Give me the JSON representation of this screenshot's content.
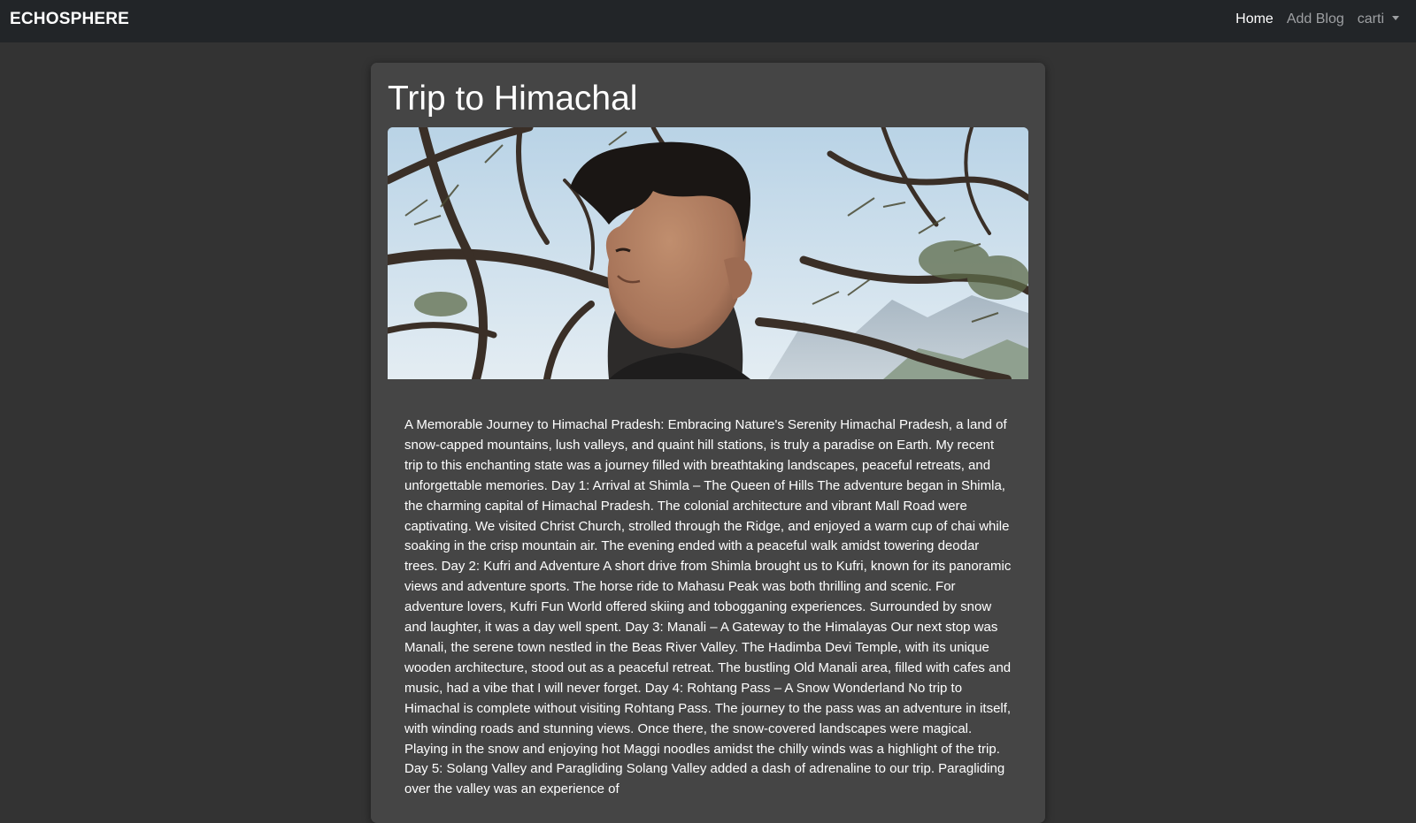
{
  "navbar": {
    "brand": "ECHOSPHERE",
    "links": [
      {
        "label": "Home",
        "active": true
      },
      {
        "label": "Add Blog",
        "active": false
      }
    ],
    "user_menu": "carti"
  },
  "post": {
    "title": "Trip to Himachal",
    "image_alt": "Smiling young man among cedar branches with mountains in the background",
    "body": "A Memorable Journey to Himachal Pradesh: Embracing Nature's Serenity Himachal Pradesh, a land of snow-capped mountains, lush valleys, and quaint hill stations, is truly a paradise on Earth. My recent trip to this enchanting state was a journey filled with breathtaking landscapes, peaceful retreats, and unforgettable memories. Day 1: Arrival at Shimla – The Queen of Hills The adventure began in Shimla, the charming capital of Himachal Pradesh. The colonial architecture and vibrant Mall Road were captivating. We visited Christ Church, strolled through the Ridge, and enjoyed a warm cup of chai while soaking in the crisp mountain air. The evening ended with a peaceful walk amidst towering deodar trees. Day 2: Kufri and Adventure A short drive from Shimla brought us to Kufri, known for its panoramic views and adventure sports. The horse ride to Mahasu Peak was both thrilling and scenic. For adventure lovers, Kufri Fun World offered skiing and tobogganing experiences. Surrounded by snow and laughter, it was a day well spent. Day 3: Manali – A Gateway to the Himalayas Our next stop was Manali, the serene town nestled in the Beas River Valley. The Hadimba Devi Temple, with its unique wooden architecture, stood out as a peaceful retreat. The bustling Old Manali area, filled with cafes and music, had a vibe that I will never forget. Day 4: Rohtang Pass – A Snow Wonderland No trip to Himachal is complete without visiting Rohtang Pass. The journey to the pass was an adventure in itself, with winding roads and stunning views. Once there, the snow-covered landscapes were magical. Playing in the snow and enjoying hot Maggi noodles amidst the chilly winds was a highlight of the trip. Day 5: Solang Valley and Paragliding Solang Valley added a dash of adrenaline to our trip. Paragliding over the valley was an experience of"
  },
  "colors": {
    "page_bg": "#333333",
    "navbar_bg": "#222528",
    "card_bg": "#454545",
    "text": "#ffffff",
    "nav_muted": "#9ea0a3"
  }
}
